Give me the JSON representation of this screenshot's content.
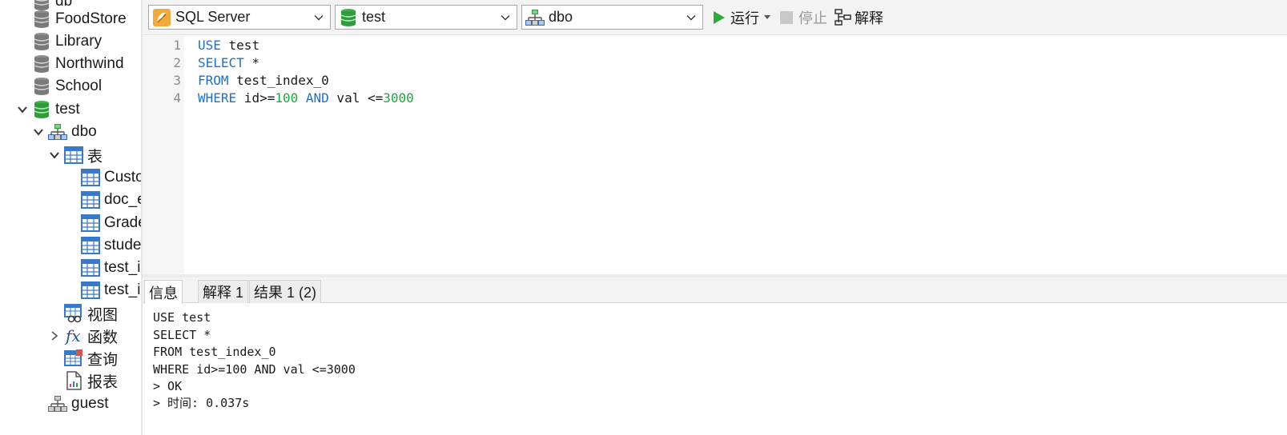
{
  "tree": {
    "items": [
      {
        "label": "db",
        "icon": "database-icon"
      },
      {
        "label": "FoodStore",
        "icon": "database-icon"
      },
      {
        "label": "Library",
        "icon": "database-icon"
      },
      {
        "label": "Northwind",
        "icon": "database-icon"
      },
      {
        "label": "School",
        "icon": "database-icon"
      },
      {
        "label": "test",
        "icon": "database-icon",
        "expanded": true,
        "color": "#2e9e3a"
      },
      {
        "label": "dbo",
        "icon": "schema-icon",
        "expanded": true
      },
      {
        "label": "表",
        "icon": "table-icon",
        "expanded": true
      },
      {
        "label": "Custo",
        "icon": "table-icon"
      },
      {
        "label": "doc_e",
        "icon": "table-icon"
      },
      {
        "label": "Grade",
        "icon": "table-icon"
      },
      {
        "label": "stude",
        "icon": "table-icon"
      },
      {
        "label": "test_i",
        "icon": "table-icon"
      },
      {
        "label": "test_i",
        "icon": "table-icon"
      },
      {
        "label": "视图",
        "icon": "view-icon"
      },
      {
        "label": "函数",
        "icon": "function-icon",
        "collapsed": true
      },
      {
        "label": "查询",
        "icon": "query-icon"
      },
      {
        "label": "报表",
        "icon": "report-icon"
      },
      {
        "label": "guest",
        "icon": "schema-icon"
      }
    ]
  },
  "toolbar": {
    "connection": "SQL Server",
    "database": "test",
    "schema": "dbo",
    "run_label": "运行",
    "stop_label": "停止",
    "explain_label": "解释"
  },
  "editor": {
    "line_numbers": [
      "1",
      "2",
      "3",
      "4"
    ],
    "lines": [
      {
        "parts": [
          {
            "t": "USE",
            "c": "kw"
          },
          {
            "t": " test",
            "c": ""
          }
        ]
      },
      {
        "parts": [
          {
            "t": "SELECT",
            "c": "kw"
          },
          {
            "t": " *",
            "c": ""
          }
        ]
      },
      {
        "parts": [
          {
            "t": "FROM",
            "c": "kw"
          },
          {
            "t": " test_index_0",
            "c": ""
          }
        ]
      },
      {
        "parts": [
          {
            "t": "WHERE",
            "c": "kw"
          },
          {
            "t": " id>=",
            "c": ""
          },
          {
            "t": "100",
            "c": "num"
          },
          {
            "t": " ",
            "c": ""
          },
          {
            "t": "AND",
            "c": "kw"
          },
          {
            "t": " val <=",
            "c": ""
          },
          {
            "t": "3000",
            "c": "num"
          }
        ]
      }
    ]
  },
  "tabs": [
    {
      "label": "信息",
      "active": true
    },
    {
      "label": "解释 1",
      "active": false
    },
    {
      "label": "结果 1 (2)",
      "active": false
    }
  ],
  "output": {
    "lines": [
      "USE test",
      "SELECT *",
      "FROM test_index_0",
      "WHERE id>=100 AND val <=3000",
      "> OK",
      "> 时间: 0.037s"
    ]
  },
  "colors": {
    "keyword": "#1f6fd1",
    "number": "#1aaa3c",
    "run_green": "#2eaa3a",
    "db_green": "#2e9e3a"
  }
}
